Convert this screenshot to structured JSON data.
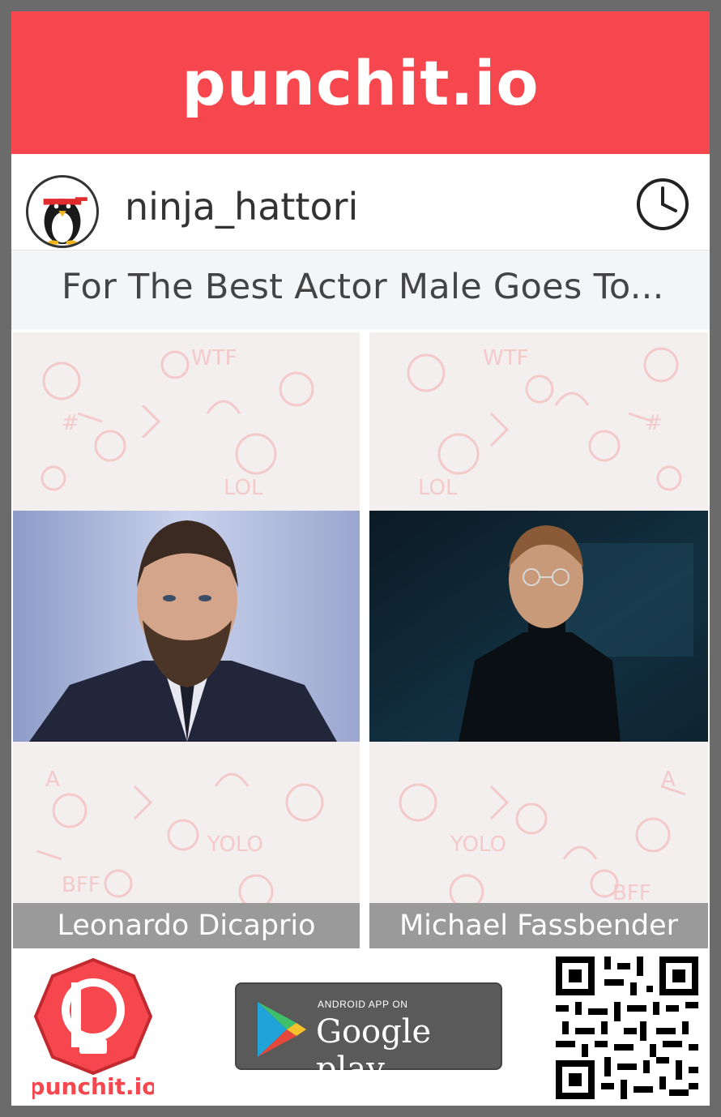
{
  "brand": {
    "name": "punchit.io"
  },
  "user": {
    "username": "ninja_hattori"
  },
  "question": {
    "text": "For The Best Actor Male Goes To..."
  },
  "options": [
    {
      "label": "Leonardo Dicaprio"
    },
    {
      "label": "Michael Fassbender"
    }
  ],
  "footer": {
    "logo_text": "punchit.io",
    "store_badge": {
      "line1": "ANDROID APP ON",
      "line2": "Google play"
    }
  },
  "colors": {
    "brand_red": "#f5474d",
    "frame_gray": "#6b6b6b",
    "question_bg": "#f4f5f7",
    "caption_bg": "#9a9a9a"
  },
  "icons": [
    "ninja-avatar-icon",
    "clock-icon",
    "google-play-icon",
    "qr-code-icon"
  ]
}
